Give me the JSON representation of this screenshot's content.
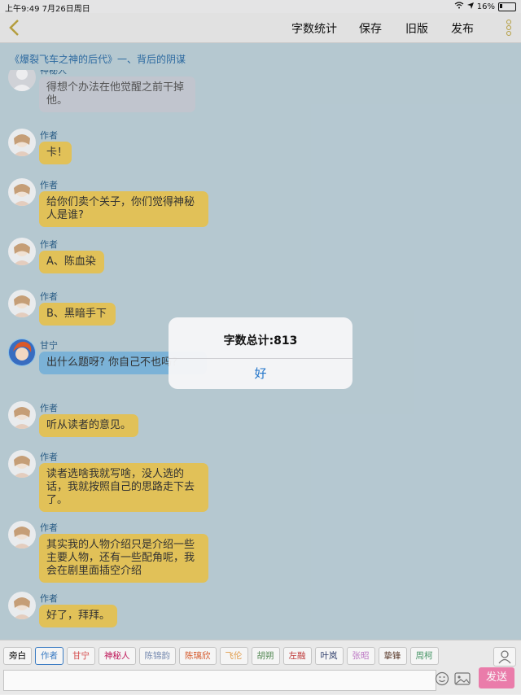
{
  "status": {
    "time": "上午9:49",
    "date": "7月26日周日",
    "battery": "16%"
  },
  "toolbar": {
    "word_count": "字数统计",
    "save": "保存",
    "old_version": "旧版",
    "publish": "发布"
  },
  "chapter_title": "《爆裂飞车之神的后代》一、背后的阴谋",
  "messages": [
    {
      "name": "神秘人",
      "text": "得想个办法在他觉醒之前干掉他。",
      "kind": "mystery"
    },
    {
      "name": "作者",
      "text": "卡！",
      "kind": "author"
    },
    {
      "name": "作者",
      "text": "给你们卖个关子，你们觉得神秘人是谁?",
      "kind": "author"
    },
    {
      "name": "作者",
      "text": "A、陈血染",
      "kind": "author"
    },
    {
      "name": "作者",
      "text": "B、黑暗手下",
      "kind": "author"
    },
    {
      "name": "甘宁",
      "text": "出什么题呀? 你自己不也吗?",
      "kind": "ganning"
    },
    {
      "name": "作者",
      "text": "听从读者的意见。",
      "kind": "author"
    },
    {
      "name": "作者",
      "text": "读者选啥我就写啥，没人选的话，我就按照自己的思路走下去了。",
      "kind": "author"
    },
    {
      "name": "作者",
      "text": "其实我的人物介绍只是介绍一些主要人物，还有一些配角呢，我会在剧里面插空介绍",
      "kind": "author"
    },
    {
      "name": "作者",
      "text": "好了，拜拜。",
      "kind": "author"
    }
  ],
  "characters": [
    {
      "label": "旁白",
      "color": "#333333"
    },
    {
      "label": "作者",
      "color": "#3d7fc7"
    },
    {
      "label": "甘宁",
      "color": "#d94b4b"
    },
    {
      "label": "神秘人",
      "color": "#c2185b"
    },
    {
      "label": "陈锦韵",
      "color": "#7b8fb5"
    },
    {
      "label": "陈璃欣",
      "color": "#d95a2b"
    },
    {
      "label": "飞伦",
      "color": "#e6a04b"
    },
    {
      "label": "胡朔",
      "color": "#5a8f5a"
    },
    {
      "label": "左融",
      "color": "#c23a3a"
    },
    {
      "label": "叶岚",
      "color": "#2b3b6b"
    },
    {
      "label": "张昭",
      "color": "#c07ac8"
    },
    {
      "label": "挚锋",
      "color": "#5a3a2a"
    },
    {
      "label": "周柯",
      "color": "#4a9a6a"
    }
  ],
  "input": {
    "placeholder": "",
    "send": "发送"
  },
  "alert": {
    "title": "字数总计:813",
    "ok": "好"
  }
}
